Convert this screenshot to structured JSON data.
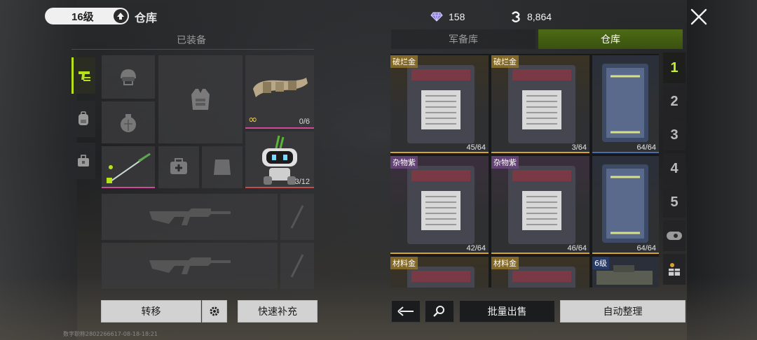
{
  "header": {
    "level": "16级",
    "title": "仓库",
    "gems": "158",
    "coins": "8,864"
  },
  "left_panel": {
    "section_title": "已装备",
    "belt_count": "0/6",
    "belt_infinity": "∞",
    "robot_count": "3/12",
    "transfer_label": "转移",
    "quick_refill_label": "快速补充"
  },
  "right_panel": {
    "tabs": [
      {
        "label": "军备库",
        "active": false
      },
      {
        "label": "仓库",
        "active": true
      }
    ],
    "grid": [
      {
        "name": "破烂金",
        "count": "45/64",
        "tier": "gold"
      },
      {
        "name": "破烂金",
        "count": "3/64",
        "tier": "gold"
      },
      {
        "name": "",
        "count": "64/64",
        "tier": "blue"
      },
      {
        "name": "杂物紫",
        "count": "42/64",
        "tier": "purple"
      },
      {
        "name": "杂物紫",
        "count": "46/64",
        "tier": "purple"
      },
      {
        "name": "",
        "count": "64/64",
        "tier": "blue"
      },
      {
        "name": "材料金",
        "count": "",
        "tier": "gold"
      },
      {
        "name": "材料金",
        "count": "",
        "tier": "gold"
      },
      {
        "name": "6级",
        "count": "",
        "tier": "blue"
      }
    ],
    "pages": [
      "1",
      "2",
      "3",
      "4",
      "5"
    ],
    "batch_sell_label": "批量出售",
    "auto_sort_label": "自动整理"
  },
  "watermark": "数字职称2802266617-08-18-18:21",
  "colors": {
    "accent": "#b7e21a",
    "tab_active": "#4d6b14",
    "gold": "#d9a22f",
    "purple": "#8a4fa8",
    "blue": "#4b6bb0",
    "pink": "#d04a9a",
    "red": "#c84a4a"
  }
}
